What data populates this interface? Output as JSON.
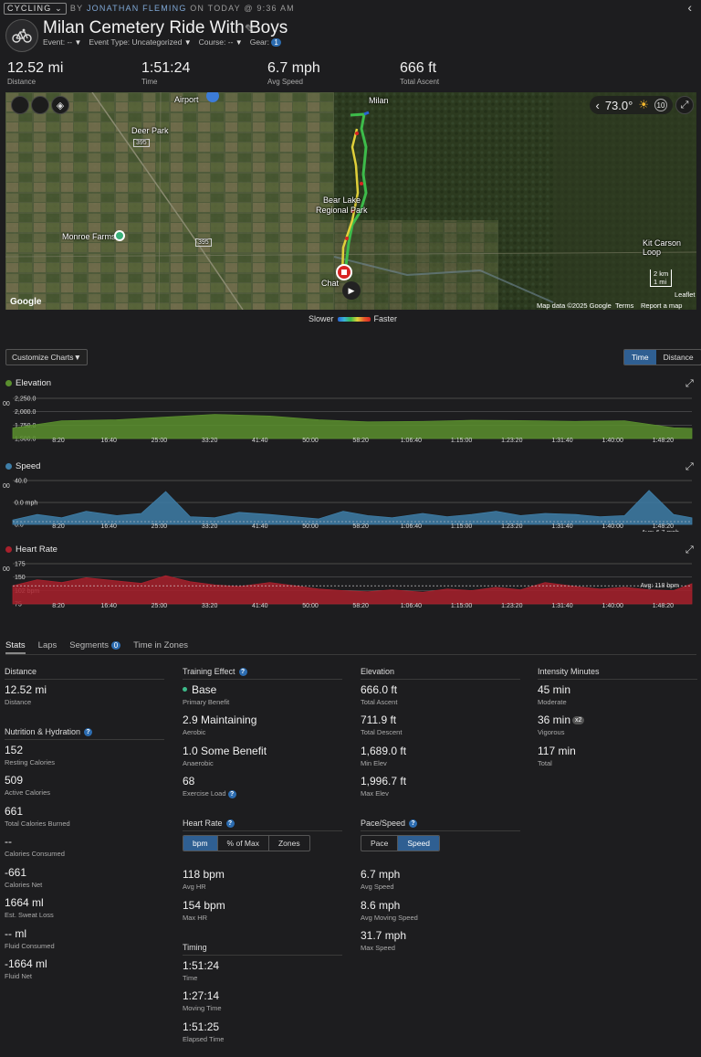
{
  "header": {
    "sport": "CYCLING",
    "by_prefix": "BY",
    "author": "JONATHAN FLEMING",
    "when": "ON TODAY @ 9:36 AM",
    "title": "Milan Cemetery Ride With Boys",
    "meta": {
      "event": "Event: --",
      "event_type": "Event Type: Uncategorized",
      "course": "Course: --",
      "gear_label": "Gear:",
      "gear_count": "1"
    }
  },
  "summary": [
    {
      "value": "12.52 mi",
      "label": "Distance"
    },
    {
      "value": "1:51:24",
      "label": "Time"
    },
    {
      "value": "6.7 mph",
      "label": "Avg Speed"
    },
    {
      "value": "666 ft",
      "label": "Total Ascent"
    }
  ],
  "map": {
    "weather_temp": "73.0°",
    "weather_count": "10",
    "labels": {
      "milan": "Milan",
      "deer_park": "Deer Park",
      "airport": "Airport",
      "bear_lake": "Bear Lake",
      "regional_park": "Regional Park",
      "monroe_farms": "Monroe Farms",
      "kit_carson": "Kit Carson Loop",
      "chat": "Chat",
      "hwy": "395"
    },
    "scale_km": "2 km",
    "scale_mi": "1 mi",
    "google": "Google",
    "map_data": "Map data ©2025 Google",
    "terms": "Terms",
    "report": "Report a map error",
    "leaflet": "Leaflet"
  },
  "legend": {
    "slower": "Slower",
    "faster": "Faster"
  },
  "charts_controls": {
    "customize": "Customize Charts",
    "time": "Time",
    "distance": "Distance"
  },
  "colors": {
    "elevation": "#5a8f2e",
    "speed": "#3e7ea8",
    "heart_rate": "#a8202c",
    "accent": "#2f5f92"
  },
  "chart_data": [
    {
      "type": "area",
      "title": "Elevation",
      "y_ticks": [
        "2,250.0",
        "2,000.0",
        "1,750.0",
        "1,500.0"
      ],
      "ylim": [
        1500,
        2250
      ],
      "x_ticks": [
        "8:20",
        "16:40",
        "25:00",
        "33:20",
        "41:40",
        "50:00",
        "58:20",
        "1:06:40",
        "1:15:00",
        "1:23:20",
        "1:31:40",
        "1:40:00",
        "1:48:20"
      ],
      "x_minutes": [
        0,
        8,
        17,
        25,
        33,
        42,
        50,
        58,
        67,
        75,
        83,
        92,
        100,
        108,
        111
      ],
      "values": [
        1695,
        1830,
        1850,
        1900,
        1950,
        1920,
        1850,
        1810,
        1820,
        1840,
        1835,
        1820,
        1830,
        1700,
        1690
      ],
      "left_label": "00"
    },
    {
      "type": "area",
      "title": "Speed",
      "y_ticks": [
        "40.0",
        "0.0 mph",
        "0.0"
      ],
      "ylim": [
        0,
        40
      ],
      "x_ticks": [
        "8:20",
        "16:40",
        "25:00",
        "33:20",
        "41:40",
        "50:00",
        "58:20",
        "1:06:40",
        "1:15:00",
        "1:23:20",
        "1:31:40",
        "1:40:00",
        "1:48:20"
      ],
      "x_minutes": [
        0,
        4,
        8,
        12,
        17,
        21,
        25,
        29,
        33,
        37,
        42,
        46,
        50,
        54,
        58,
        62,
        67,
        71,
        75,
        79,
        83,
        87,
        92,
        96,
        100,
        104,
        108,
        111
      ],
      "values": [
        4,
        9,
        6,
        12,
        8,
        10,
        30,
        7,
        6,
        11,
        9,
        7,
        5,
        12,
        8,
        6,
        10,
        7,
        9,
        12,
        8,
        10,
        9,
        7,
        8,
        31,
        9,
        6
      ],
      "avg_label": "Avg: 6.7 mph",
      "left_label": "00"
    },
    {
      "type": "area",
      "title": "Heart Rate",
      "y_ticks": [
        "175",
        "150",
        "102 bpm",
        "75"
      ],
      "ylim": [
        75,
        175
      ],
      "x_ticks": [
        "8:20",
        "16:40",
        "25:00",
        "33:20",
        "41:40",
        "50:00",
        "58:20",
        "1:06:40",
        "1:15:00",
        "1:23:20",
        "1:31:40",
        "1:40:00",
        "1:48:20"
      ],
      "x_minutes": [
        0,
        4,
        8,
        12,
        17,
        21,
        25,
        29,
        33,
        37,
        42,
        46,
        50,
        54,
        58,
        62,
        67,
        71,
        75,
        79,
        83,
        87,
        92,
        96,
        100,
        104,
        108,
        111
      ],
      "values": [
        120,
        135,
        128,
        140,
        132,
        126,
        145,
        130,
        122,
        118,
        128,
        120,
        112,
        108,
        105,
        110,
        104,
        112,
        108,
        116,
        110,
        128,
        118,
        112,
        116,
        110,
        108,
        125
      ],
      "avg_label": "Avg: 118 bpm",
      "left_label": "00"
    }
  ],
  "tabs": {
    "stats": "Stats",
    "laps": "Laps",
    "segments": "Segments",
    "segments_count": "0",
    "time_in_zones": "Time in Zones"
  },
  "stats": {
    "distance_header": "Distance",
    "distance": {
      "value": "12.52 mi",
      "label": "Distance"
    },
    "nutrition_header": "Nutrition & Hydration",
    "nutrition": [
      {
        "value": "152",
        "label": "Resting Calories"
      },
      {
        "value": "509",
        "label": "Active Calories"
      },
      {
        "value": "661",
        "label": "Total Calories Burned"
      },
      {
        "value": "--",
        "label": "Calories Consumed"
      },
      {
        "value": "-661",
        "label": "Calories Net"
      },
      {
        "value": "1664 ml",
        "label": "Est. Sweat Loss"
      },
      {
        "value": "-- ml",
        "label": "Fluid Consumed"
      },
      {
        "value": "-1664 ml",
        "label": "Fluid Net"
      }
    ],
    "training_header": "Training Effect",
    "training": [
      {
        "value": "Base",
        "label": "Primary Benefit"
      },
      {
        "value": "2.9 Maintaining",
        "label": "Aerobic"
      },
      {
        "value": "1.0 Some Benefit",
        "label": "Anaerobic"
      },
      {
        "value": "68",
        "label": "Exercise Load"
      }
    ],
    "hr_header": "Heart Rate",
    "hr_tabs": [
      "bpm",
      "% of Max",
      "Zones"
    ],
    "hr": [
      {
        "value": "118 bpm",
        "label": "Avg HR"
      },
      {
        "value": "154 bpm",
        "label": "Max HR"
      }
    ],
    "timing_header": "Timing",
    "timing": [
      {
        "value": "1:51:24",
        "label": "Time"
      },
      {
        "value": "1:27:14",
        "label": "Moving Time"
      },
      {
        "value": "1:51:25",
        "label": "Elapsed Time"
      }
    ],
    "elevation_header": "Elevation",
    "elevation": [
      {
        "value": "666.0 ft",
        "label": "Total Ascent"
      },
      {
        "value": "711.9 ft",
        "label": "Total Descent"
      },
      {
        "value": "1,689.0 ft",
        "label": "Min Elev"
      },
      {
        "value": "1,996.7 ft",
        "label": "Max Elev"
      }
    ],
    "pace_header": "Pace/Speed",
    "pace_tabs": [
      "Pace",
      "Speed"
    ],
    "pace": [
      {
        "value": "6.7 mph",
        "label": "Avg Speed"
      },
      {
        "value": "8.6 mph",
        "label": "Avg Moving Speed"
      },
      {
        "value": "31.7 mph",
        "label": "Max Speed"
      }
    ],
    "intensity_header": "Intensity Minutes",
    "intensity": [
      {
        "value": "45 min",
        "label": "Moderate"
      },
      {
        "value": "36 min",
        "label": "Vigorous",
        "badge": "x2"
      },
      {
        "value": "117 min",
        "label": "Total"
      }
    ]
  }
}
